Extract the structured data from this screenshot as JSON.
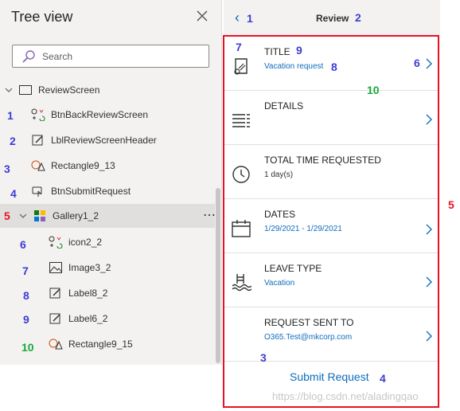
{
  "tree": {
    "title": "Tree view",
    "search_placeholder": "Search",
    "nodes": [
      {
        "label": "ReviewScreen"
      },
      {
        "label": "BtnBackReviewScreen"
      },
      {
        "label": "LblReviewScreenHeader"
      },
      {
        "label": "Rectangle9_13"
      },
      {
        "label": "BtnSubmitRequest"
      },
      {
        "label": "Gallery1_2"
      },
      {
        "label": "icon2_2"
      },
      {
        "label": "Image3_2"
      },
      {
        "label": "Label8_2"
      },
      {
        "label": "Label6_2"
      },
      {
        "label": "Rectangle9_15"
      }
    ],
    "more": "⋯"
  },
  "annotations": {
    "tree": [
      "1",
      "2",
      "3",
      "4",
      "5",
      "6",
      "7",
      "8",
      "9",
      "10"
    ],
    "screen": {
      "back": "1",
      "header": "2",
      "gallery": "5",
      "title_icon": "7",
      "title_label": "9",
      "title_value": "8",
      "chevron": "6",
      "row": "10",
      "rect": "3",
      "submit": "4"
    }
  },
  "screen": {
    "back_glyph": "‹",
    "header": "Review",
    "rows": [
      {
        "title": "TITLE",
        "value": "Vacation request",
        "icon": "certificate-icon",
        "chevron": true
      },
      {
        "title": "DETAILS",
        "value": "",
        "icon": "list-icon",
        "chevron": true
      },
      {
        "title": "TOTAL TIME REQUESTED",
        "value": "1 day(s)",
        "icon": "clock-icon",
        "chevron": false
      },
      {
        "title": "DATES",
        "value": "1/29/2021 - 1/29/2021",
        "icon": "calendar-icon",
        "chevron": true
      },
      {
        "title": "LEAVE TYPE",
        "value": "Vacation",
        "icon": "pool-icon",
        "chevron": true
      },
      {
        "title": "REQUEST SENT TO",
        "value": "O365.Test@mkcorp.com",
        "icon": "",
        "chevron": true
      }
    ],
    "submit": "Submit Request"
  },
  "watermark": "https://blog.csdn.net/aladingqao",
  "colors": {
    "accent": "#0f6cbd",
    "annotation_blue": "#3c3cd6",
    "annotation_red": "#e81123",
    "annotation_green": "#1aa83a"
  }
}
